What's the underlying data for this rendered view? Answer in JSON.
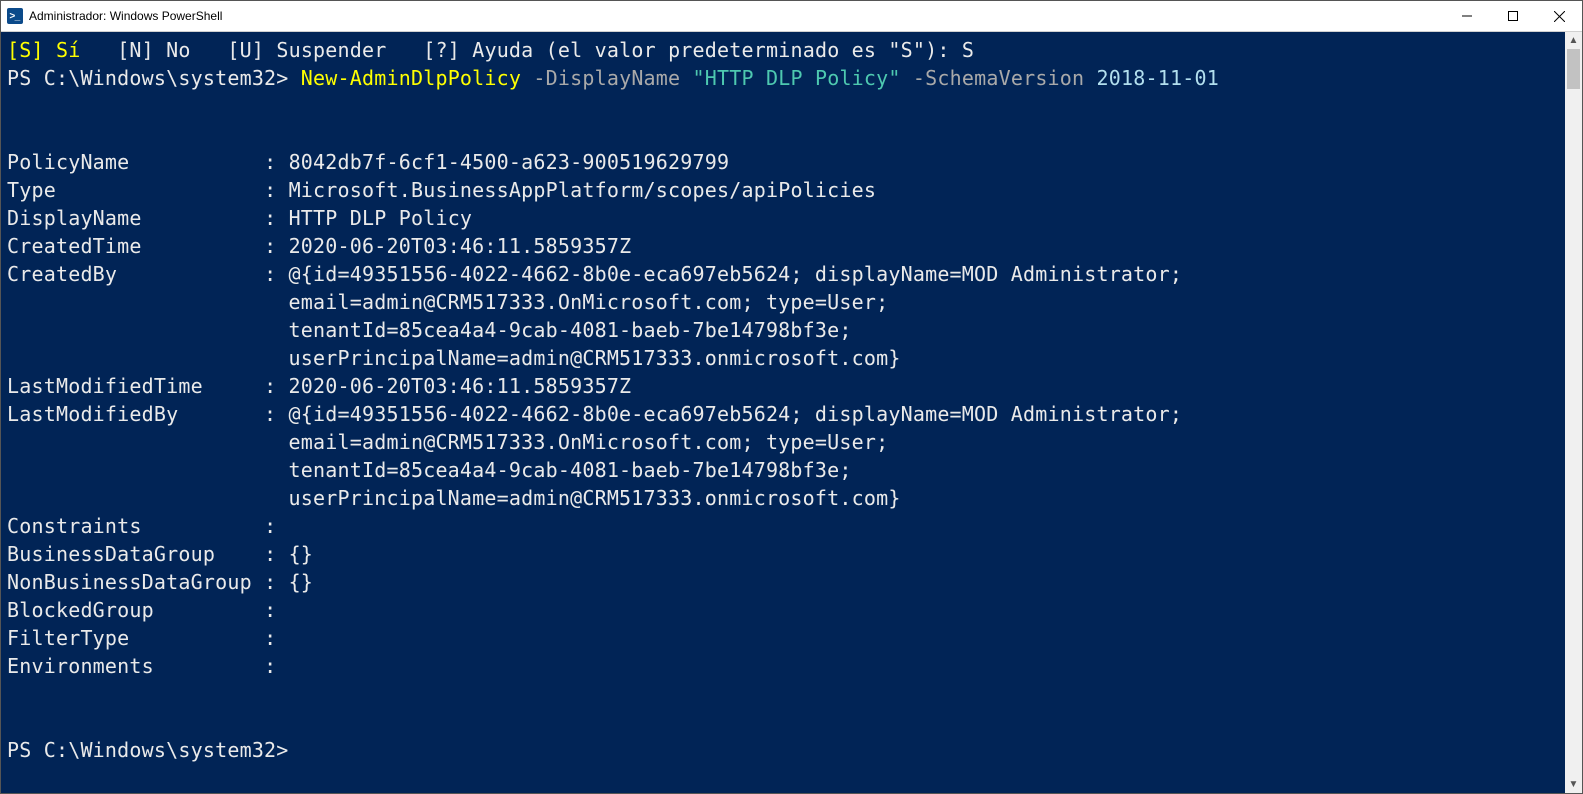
{
  "window": {
    "title": "Administrador: Windows PowerShell",
    "icon_label": ">_"
  },
  "confirm_line": {
    "s": "[S] Sí",
    "n": "[N] No",
    "u": "[U] Suspender",
    "q": "[?] Ayuda (el valor predeterminado es \"S\"):",
    "answer": "S"
  },
  "prompt": {
    "path": "PS C:\\Windows\\system32>",
    "cmd": "New-AdminDlpPolicy",
    "param1": "-DisplayName",
    "string": "\"HTTP DLP Policy\"",
    "param2": "-SchemaVersion",
    "value2": "2018-11-01"
  },
  "output": {
    "PolicyName": "8042db7f-6cf1-4500-a623-900519629799",
    "Type": "Microsoft.BusinessAppPlatform/scopes/apiPolicies",
    "DisplayName": "HTTP DLP Policy",
    "CreatedTime": "2020-06-20T03:46:11.5859357Z",
    "CreatedBy_l1": "@{id=49351556-4022-4662-8b0e-eca697eb5624; displayName=MOD Administrator;",
    "CreatedBy_l2": "email=admin@CRM517333.OnMicrosoft.com; type=User;",
    "CreatedBy_l3": "tenantId=85cea4a4-9cab-4081-baeb-7be14798bf3e;",
    "CreatedBy_l4": "userPrincipalName=admin@CRM517333.onmicrosoft.com}",
    "LastModifiedTime": "2020-06-20T03:46:11.5859357Z",
    "LastModBy_l1": "@{id=49351556-4022-4662-8b0e-eca697eb5624; displayName=MOD Administrator;",
    "LastModBy_l2": "email=admin@CRM517333.OnMicrosoft.com; type=User;",
    "LastModBy_l3": "tenantId=85cea4a4-9cab-4081-baeb-7be14798bf3e;",
    "LastModBy_l4": "userPrincipalName=admin@CRM517333.onmicrosoft.com}",
    "Constraints": "",
    "BusinessDataGroup": "{}",
    "NonBusinessDataGroup": "{}",
    "BlockedGroup": "",
    "FilterType": "",
    "Environments": ""
  },
  "labels": {
    "PolicyName": "PolicyName",
    "Type": "Type",
    "DisplayName": "DisplayName",
    "CreatedTime": "CreatedTime",
    "CreatedBy": "CreatedBy",
    "LastModifiedTime": "LastModifiedTime",
    "LastModifiedBy": "LastModifiedBy",
    "Constraints": "Constraints",
    "BusinessDataGroup": "BusinessDataGroup",
    "NonBusinessDataGroup": "NonBusinessDataGroup",
    "BlockedGroup": "BlockedGroup",
    "FilterType": "FilterType",
    "Environments": "Environments"
  },
  "final_prompt": "PS C:\\Windows\\system32>"
}
